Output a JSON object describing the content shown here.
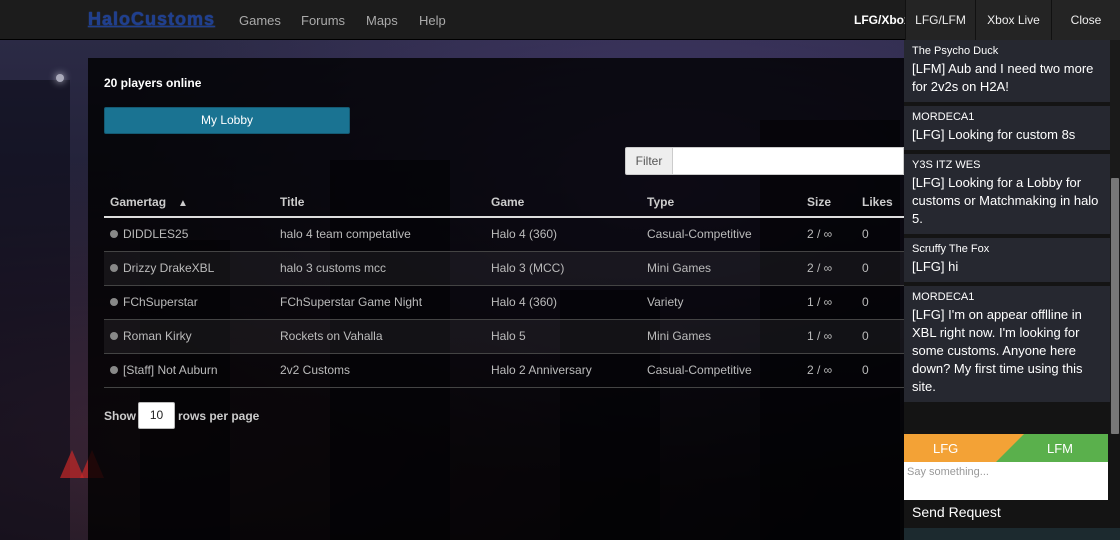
{
  "site": {
    "logo": "HaloCustoms",
    "nav": [
      "Games",
      "Forums",
      "Maps",
      "Help"
    ]
  },
  "topbar": {
    "lfg_xbox": "LFG/Xbox",
    "tabs": [
      "LFG/LFM",
      "Xbox Live",
      "Close"
    ]
  },
  "main": {
    "online_text": "20 players online",
    "lobby_button": "My Lobby",
    "filter_label": "Filter",
    "filter_value": "",
    "columns": [
      "Gamertag",
      "Title",
      "Game",
      "Type",
      "Size",
      "Likes"
    ],
    "sort_indicator": "▲",
    "rows": [
      {
        "gamertag": "DIDDLES25",
        "title": "halo 4 team competative",
        "game": "Halo 4 (360)",
        "type": "Casual-Competitive",
        "size": "2 / ∞",
        "likes": "0"
      },
      {
        "gamertag": "Drizzy DrakeXBL",
        "title": "halo 3 customs mcc",
        "game": "Halo 3 (MCC)",
        "type": "Mini Games",
        "size": "2 / ∞",
        "likes": "0"
      },
      {
        "gamertag": "FChSuperstar",
        "title": "FChSuperstar Game Night",
        "game": "Halo 4 (360)",
        "type": "Variety",
        "size": "1 / ∞",
        "likes": "0"
      },
      {
        "gamertag": "Roman Kirky",
        "title": "Rockets on Vahalla",
        "game": "Halo 5",
        "type": "Mini Games",
        "size": "1 / ∞",
        "likes": "0"
      },
      {
        "gamertag": "[Staff] Not Auburn",
        "title": "2v2 Customs",
        "game": "Halo 2 Anniversary",
        "type": "Casual-Competitive",
        "size": "2 / ∞",
        "likes": "0"
      }
    ],
    "show_label": "Show",
    "rows_per_page": "10",
    "rows_label": "rows per page"
  },
  "chat": {
    "messages": [
      {
        "author": "The Psycho Duck",
        "text": "[LFM] Aub and I need two more for 2v2s on H2A!"
      },
      {
        "author": "MORDECA1",
        "text": "[LFG] Looking for custom 8s"
      },
      {
        "author": "Y3S ITZ WES",
        "text": "[LFG] Looking for a Lobby for customs or Matchmaking in halo 5."
      },
      {
        "author": "Scruffy The Fox",
        "text": "[LFG] hi"
      },
      {
        "author": "MORDECA1",
        "text": "[LFG] I'm on appear offlline in XBL right now. I'm looking for some customs. Anyone here down? My first time using this site."
      }
    ],
    "lfg_label": "LFG",
    "lfm_label": "LFM",
    "placeholder": "Say something...",
    "send_label": "Send Request"
  },
  "colors": {
    "lobby_button": "#1a7392",
    "lfg": "#f3a236",
    "lfm": "#5ab04c"
  }
}
